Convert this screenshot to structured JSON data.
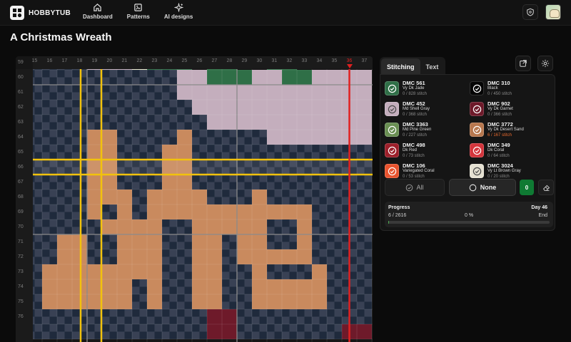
{
  "app": {
    "brand": "HOBBYTUB"
  },
  "nav": [
    {
      "label": "Dashboard",
      "icon": "home-icon"
    },
    {
      "label": "Patterns",
      "icon": "patterns-icon"
    },
    {
      "label": "AI designs",
      "icon": "sparkle-icon"
    }
  ],
  "page": {
    "title": "A Christmas Wreath"
  },
  "grid": {
    "col_labels": [
      "15",
      "16",
      "17",
      "18",
      "19",
      "20",
      "21",
      "22",
      "23",
      "24",
      "25",
      "26",
      "27",
      "28",
      "29",
      "30",
      "31",
      "32",
      "33",
      "34",
      "35",
      "36",
      "37"
    ],
    "row_labels": [
      "59",
      "60",
      "61",
      "62",
      "63",
      "64",
      "65",
      "66",
      "67",
      "68",
      "69",
      "70",
      "71",
      "72",
      "73",
      "74",
      "75",
      "76"
    ],
    "highlight_col": "36"
  },
  "tabs": [
    {
      "label": "Stitching",
      "active": true
    },
    {
      "label": "Text",
      "active": false
    }
  ],
  "threads": [
    {
      "code": "DMC 561",
      "name": "Vy Dk Jade",
      "count": "0 / 828 stitch",
      "color": "#2f6f47",
      "done": true
    },
    {
      "code": "DMC 310",
      "name": "Black",
      "count": "0 / 450 stitch",
      "color": "#050505",
      "done": true
    },
    {
      "code": "DMC 452",
      "name": "Md Shell Gray",
      "count": "0 / 368 stitch",
      "color": "#c4aebd",
      "done": true
    },
    {
      "code": "DMC 902",
      "name": "Vy Dk Garnet",
      "count": "0 / 366 stitch",
      "color": "#6e1a2a",
      "done": true
    },
    {
      "code": "DMC 3363",
      "name": "Md Pine Green",
      "count": "0 / 227 stitch",
      "color": "#6a8f53",
      "done": true
    },
    {
      "code": "DMC 3772",
      "name": "Vy Dk Desert Sand",
      "count": "6 / 167 stitch",
      "color": "#b7774e",
      "done": true,
      "highlight": true
    },
    {
      "code": "DMC 498",
      "name": "Dk Red",
      "count": "0 / 73 stitch",
      "color": "#9d1f2a",
      "done": true
    },
    {
      "code": "DMC 349",
      "name": "Dk Coral",
      "count": "0 / 64 stitch",
      "color": "#d3353c",
      "done": true
    },
    {
      "code": "DMC 106",
      "name": "Variegated Coral",
      "count": "0 / 53 stitch",
      "color": "#e8532e",
      "done": true
    },
    {
      "code": "DMC 3024",
      "name": "Vy Lt Brown Gray",
      "count": "0 / 20 stitch",
      "color": "#e5e1d2",
      "done": true
    }
  ],
  "actions": {
    "all_label": "All",
    "none_label": "None",
    "selected_count": "0"
  },
  "progress": {
    "label": "Progress",
    "day": "Day 46",
    "count": "6 / 2616",
    "percent": "0 %",
    "end": "End",
    "fraction": 0.002
  },
  "colors": {
    "tan": "#c98a5e",
    "navy": "#1f2a3c",
    "navy_light": "#394154",
    "mauve": "#c4aebd",
    "green": "#2f6f47",
    "cream": "#ecebd0",
    "garnet": "#6e1a2a",
    "black": "#050505",
    "guide_yellow": "#f2c20c",
    "guide_red": "#e02020"
  }
}
